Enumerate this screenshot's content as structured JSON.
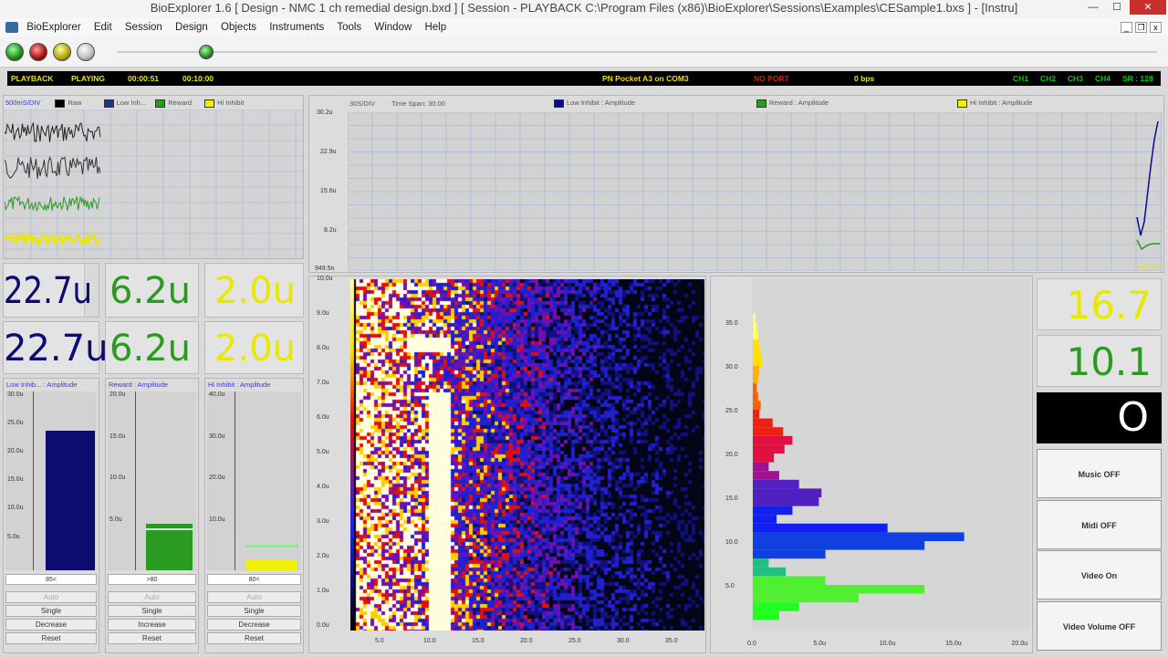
{
  "window": {
    "title": "BioExplorer 1.6  [ Design - NMC 1 ch remedial design.bxd ] [ Session - PLAYBACK C:\\Program Files (x86)\\BioExplorer\\Sessions\\Examples\\CESample1.bxs ] - [Instru]",
    "controls": {
      "minimize": "—",
      "maximize": "☐",
      "close": "✕"
    },
    "doc_controls": {
      "minimize": "_",
      "restore": "❐",
      "close": "x"
    }
  },
  "menu": [
    "BioExplorer",
    "Edit",
    "Session",
    "Design",
    "Objects",
    "Instruments",
    "Tools",
    "Window",
    "Help"
  ],
  "status": {
    "mode": "PLAYBACK",
    "state": "PLAYING",
    "elapsed": "00:00:51",
    "total": "00:10:00",
    "device": "PN Pocket A3 on COM3",
    "port": "NO PORT",
    "rate": "0 bps",
    "channels": [
      "CH1",
      "CH2",
      "CH3",
      "CH4"
    ],
    "sample_rate": "SR : 128",
    "colors": {
      "bar": "#000000",
      "text": "#e8e800",
      "device": "#f0e000",
      "port": "#cc2200",
      "channels": "#00d000"
    }
  },
  "raw_panel": {
    "scale": "500mS/DIV",
    "legend": [
      {
        "label": "Raw",
        "color": "#000000"
      },
      {
        "label": "Low Inh...",
        "color": "#1a3a80"
      },
      {
        "label": "Reward",
        "color": "#2a9a20"
      },
      {
        "label": "Hi Inhibit",
        "color": "#f0f000"
      }
    ]
  },
  "trend_panel": {
    "scale": "30S/DIV",
    "time_span": "Time Span: 30:00",
    "legend": [
      {
        "label": "Low Inhibit : Amplitude",
        "color": "#0a0a90"
      },
      {
        "label": "Reward : Amplitude",
        "color": "#2a9a20"
      },
      {
        "label": "Hi Inhibit : Amplitude",
        "color": "#f0f000"
      }
    ],
    "y_ticks": [
      "30.2u",
      "22.9u",
      "15.6u",
      "8.2u",
      "949.5n"
    ]
  },
  "numeric_displays": {
    "row1": [
      {
        "value": "22.7u",
        "color": "#0c0c70"
      },
      {
        "value": "6.2u",
        "color": "#2a9a20"
      },
      {
        "value": "2.0u",
        "color": "#e8e800"
      }
    ],
    "row2": [
      {
        "value": "22.7u",
        "color": "#0c0c70"
      },
      {
        "value": "6.2u",
        "color": "#2a9a20"
      },
      {
        "value": "2.0u",
        "color": "#e8e800"
      }
    ]
  },
  "bar_meters": [
    {
      "title": "Low Inhib... : Amplitude",
      "y_ticks": [
        "30.0u",
        "25.0u",
        "20.0u",
        "15.0u",
        "10.0u",
        "5.0u"
      ],
      "level_fraction": 0.78,
      "color": "#0c0c70",
      "threshold_label": "85<",
      "buttons": [
        "Auto",
        "Single",
        "Decrease",
        "Reset"
      ]
    },
    {
      "title": "Reward : Amplitude",
      "y_ticks": [
        "20.0u",
        "15.0u",
        "10.0u",
        "5.0u"
      ],
      "level_fraction": 0.26,
      "color": "#2a9a20",
      "threshold_label": ">80",
      "buttons": [
        "Auto",
        "Single",
        "Increase",
        "Reset"
      ]
    },
    {
      "title": "Hi Inhibit : Amplitude",
      "y_ticks": [
        "40.0u",
        "30.0u",
        "20.0u",
        "10.0u"
      ],
      "level_fraction": 0.06,
      "color": "#f0f000",
      "threshold_label": "80<",
      "buttons": [
        "Auto",
        "Single",
        "Decrease",
        "Reset"
      ]
    }
  ],
  "spectrogram": {
    "y_ticks": [
      "10.0u",
      "9.0u",
      "8.0u",
      "7.0u",
      "6.0u",
      "5.0u",
      "4.0u",
      "3.0u",
      "2.0u",
      "1.0u",
      "0.0u"
    ],
    "x_ticks": [
      "5.0",
      "10.0",
      "15.0",
      "20.0",
      "25.0",
      "30.0",
      "35.0"
    ]
  },
  "spectrum": {
    "y_ticks": [
      "35.0",
      "30.0",
      "25.0",
      "20.0",
      "15.0",
      "10.0",
      "5.0"
    ],
    "x_ticks": [
      "0.0",
      "5.0u",
      "10.0u",
      "15.0u",
      "20.0u"
    ],
    "bins": [
      {
        "freq": 35.5,
        "amp": 0.2
      },
      {
        "freq": 34.5,
        "amp": 0.3
      },
      {
        "freq": 33.5,
        "amp": 0.4
      },
      {
        "freq": 32.5,
        "amp": 0.5
      },
      {
        "freq": 31.5,
        "amp": 0.6
      },
      {
        "freq": 30.5,
        "amp": 0.7
      },
      {
        "freq": 29.5,
        "amp": 0.5
      },
      {
        "freq": 28.5,
        "amp": 0.4
      },
      {
        "freq": 27.5,
        "amp": 0.3
      },
      {
        "freq": 26.5,
        "amp": 0.4
      },
      {
        "freq": 25.5,
        "amp": 0.6
      },
      {
        "freq": 24.5,
        "amp": 0.5
      },
      {
        "freq": 23.5,
        "amp": 1.5
      },
      {
        "freq": 22.5,
        "amp": 2.3
      },
      {
        "freq": 21.5,
        "amp": 3.0
      },
      {
        "freq": 20.5,
        "amp": 2.4
      },
      {
        "freq": 19.5,
        "amp": 1.6
      },
      {
        "freq": 18.5,
        "amp": 1.2
      },
      {
        "freq": 17.5,
        "amp": 2.0
      },
      {
        "freq": 16.5,
        "amp": 3.5
      },
      {
        "freq": 15.5,
        "amp": 5.2
      },
      {
        "freq": 14.5,
        "amp": 5.0
      },
      {
        "freq": 13.5,
        "amp": 3.0
      },
      {
        "freq": 12.5,
        "amp": 1.8
      },
      {
        "freq": 11.5,
        "amp": 10.2
      },
      {
        "freq": 10.5,
        "amp": 16.0
      },
      {
        "freq": 9.5,
        "amp": 13.0
      },
      {
        "freq": 8.5,
        "amp": 5.5
      },
      {
        "freq": 7.5,
        "amp": 1.2
      },
      {
        "freq": 6.5,
        "amp": 2.5
      },
      {
        "freq": 5.5,
        "amp": 5.5
      },
      {
        "freq": 4.5,
        "amp": 13.0
      },
      {
        "freq": 3.5,
        "amp": 8.0
      },
      {
        "freq": 2.5,
        "amp": 3.5
      },
      {
        "freq": 1.5,
        "amp": 2.0
      }
    ]
  },
  "right_displays": {
    "value1": "16.7",
    "value2": "10.1",
    "indicator": "O",
    "buttons": [
      "Music OFF",
      "Midi OFF",
      "Video On",
      "Video Volume OFF"
    ]
  }
}
